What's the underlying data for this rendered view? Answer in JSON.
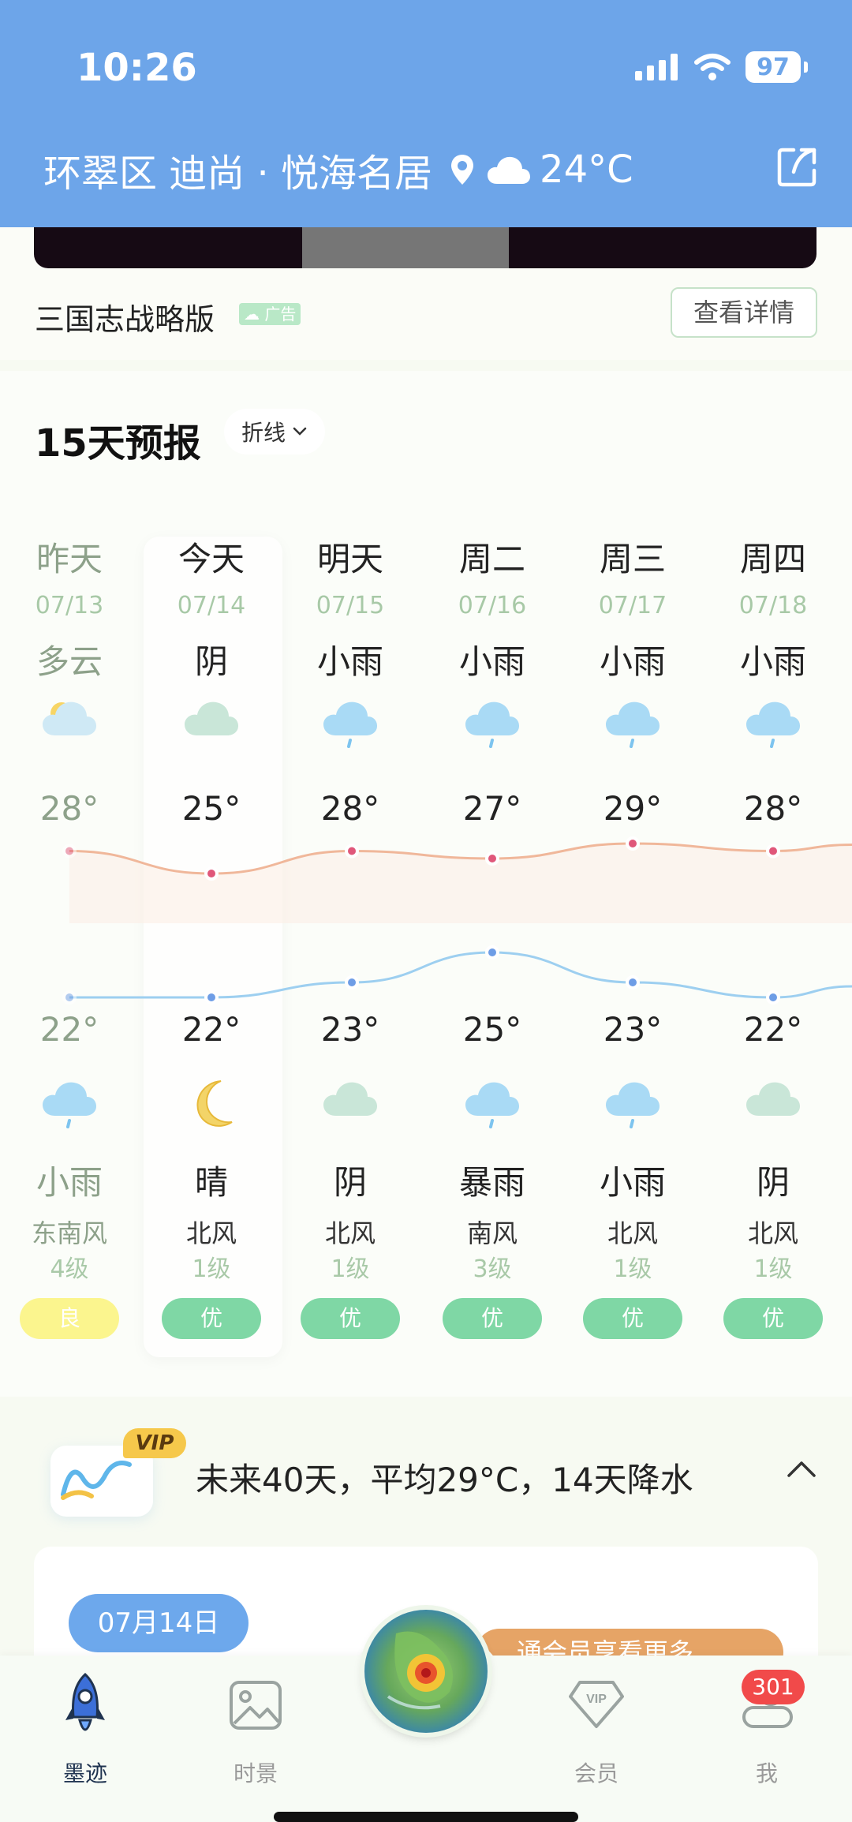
{
  "status_bar": {
    "time": "10:26",
    "battery": "97"
  },
  "header": {
    "location": "环翠区 迪尚 · 悦海名居",
    "temperature": "24°C"
  },
  "ad": {
    "title": "三国志战略版",
    "badge": "广告",
    "detail_button": "查看详情"
  },
  "forecast": {
    "title": "15天预报",
    "mode_label": "折线",
    "days": [
      {
        "day": "昨天",
        "date": "07/13",
        "day_weather": "多云",
        "day_icon": "partly-cloudy-icon",
        "high": "28°",
        "low": "22°",
        "night_icon": "light-rain-icon",
        "night_weather": "小雨",
        "wind": "东南风",
        "wind_level": "4级",
        "aqi": "良",
        "past": true
      },
      {
        "day": "今天",
        "date": "07/14",
        "day_weather": "阴",
        "day_icon": "overcast-icon",
        "high": "25°",
        "low": "22°",
        "night_icon": "moon-icon",
        "night_weather": "晴",
        "wind": "北风",
        "wind_level": "1级",
        "aqi": "优",
        "past": false
      },
      {
        "day": "明天",
        "date": "07/15",
        "day_weather": "小雨",
        "day_icon": "light-rain-icon",
        "high": "28°",
        "low": "23°",
        "night_icon": "overcast-icon",
        "night_weather": "阴",
        "wind": "北风",
        "wind_level": "1级",
        "aqi": "优",
        "past": false
      },
      {
        "day": "周二",
        "date": "07/16",
        "day_weather": "小雨",
        "day_icon": "light-rain-icon",
        "high": "27°",
        "low": "25°",
        "night_icon": "heavy-rain-icon",
        "night_weather": "暴雨",
        "wind": "南风",
        "wind_level": "3级",
        "aqi": "优",
        "past": false
      },
      {
        "day": "周三",
        "date": "07/17",
        "day_weather": "小雨",
        "day_icon": "light-rain-icon",
        "high": "29°",
        "low": "23°",
        "night_icon": "light-rain-icon",
        "night_weather": "小雨",
        "wind": "北风",
        "wind_level": "1级",
        "aqi": "优",
        "past": false
      },
      {
        "day": "周四",
        "date": "07/18",
        "day_weather": "小雨",
        "day_icon": "light-rain-icon",
        "high": "28°",
        "low": "22°",
        "night_icon": "overcast-icon",
        "night_weather": "阴",
        "wind": "北风",
        "wind_level": "1级",
        "aqi": "优",
        "past": false
      }
    ],
    "high_temps": [
      28,
      25,
      28,
      27,
      29,
      28
    ],
    "low_temps": [
      22,
      22,
      23,
      25,
      23,
      22
    ],
    "colors": {
      "high_line": "#f0b79a",
      "high_dot": "#e0577a",
      "low_line": "#9dcff0",
      "low_dot": "#6e9de6",
      "aqi_good": "#7fd7a5",
      "aqi_fair": "#fbf58e"
    }
  },
  "forty_day": {
    "vip": "VIP",
    "summary": "未来40天，平均29°C，14天降水"
  },
  "detail": {
    "date": "07月14日",
    "promo": "通会员享看更多"
  },
  "tabbar": {
    "tabs": [
      {
        "label": "墨迹",
        "icon": "rocket-icon"
      },
      {
        "label": "时景",
        "icon": "image-icon"
      },
      {
        "label": "会员",
        "icon": "vip-diamond-icon"
      },
      {
        "label": "我",
        "icon": "profile-icon"
      }
    ],
    "badge": "301",
    "center_icon": "radar-globe-icon"
  }
}
